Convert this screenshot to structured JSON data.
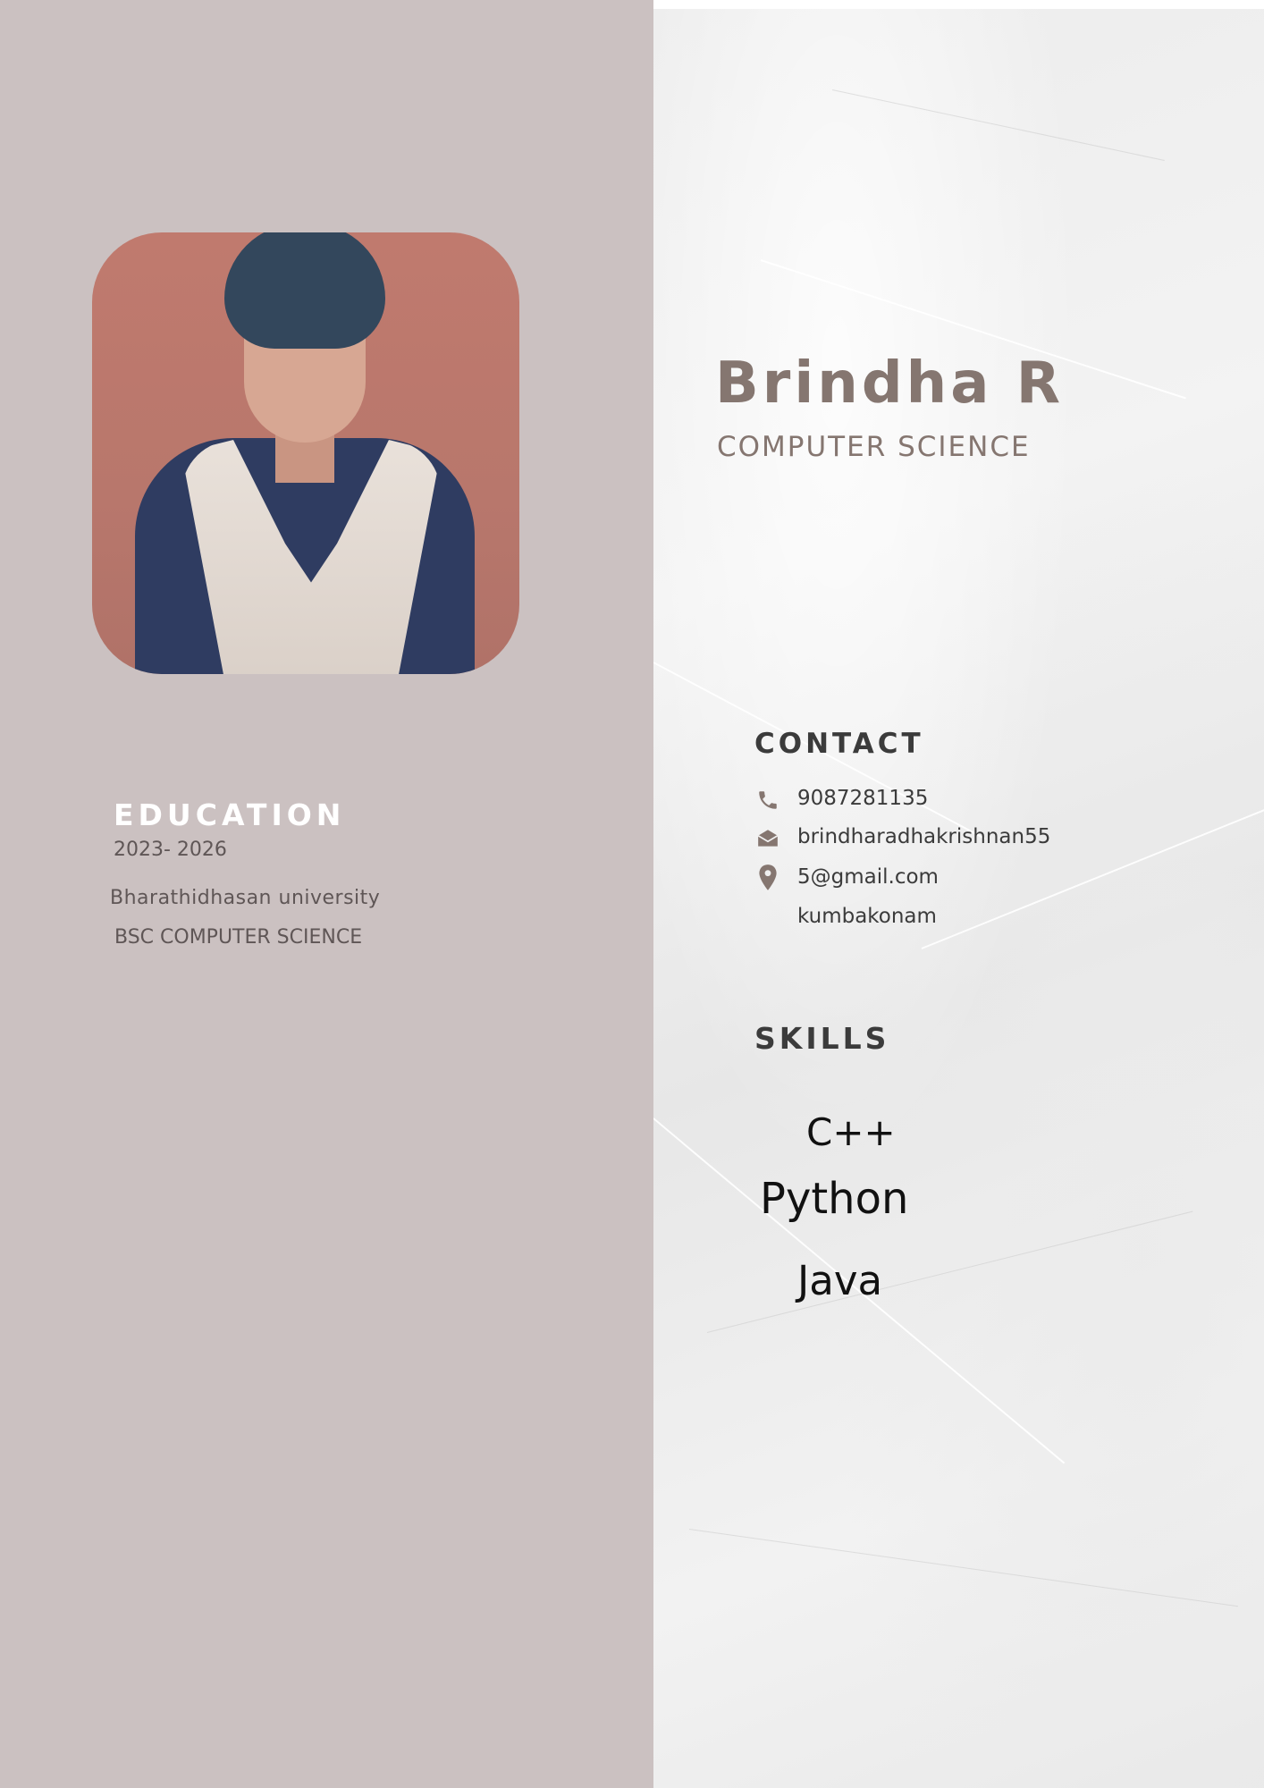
{
  "profile": {
    "name": "Brindha R",
    "role": "COMPUTER SCIENCE"
  },
  "education": {
    "heading": "EDUCATION",
    "years": "2023- 2026",
    "university": "Bharathidhasan university",
    "degree": "BSC COMPUTER SCIENCE"
  },
  "contact": {
    "heading": "CONTACT",
    "phone": "9087281135",
    "email_line1": "brindharadhakrishnan55",
    "email_line2": "5@gmail.com",
    "location": "kumbakonam",
    "icons": [
      "phone-icon",
      "envelope-icon",
      "location-pin-icon"
    ]
  },
  "skills": {
    "heading": "SKILLS",
    "items": [
      "C++",
      "Python",
      "Java"
    ]
  },
  "colors": {
    "left_panel": "#cbc1c1",
    "accent": "#857670",
    "heading_dark": "#3b3b3b"
  }
}
